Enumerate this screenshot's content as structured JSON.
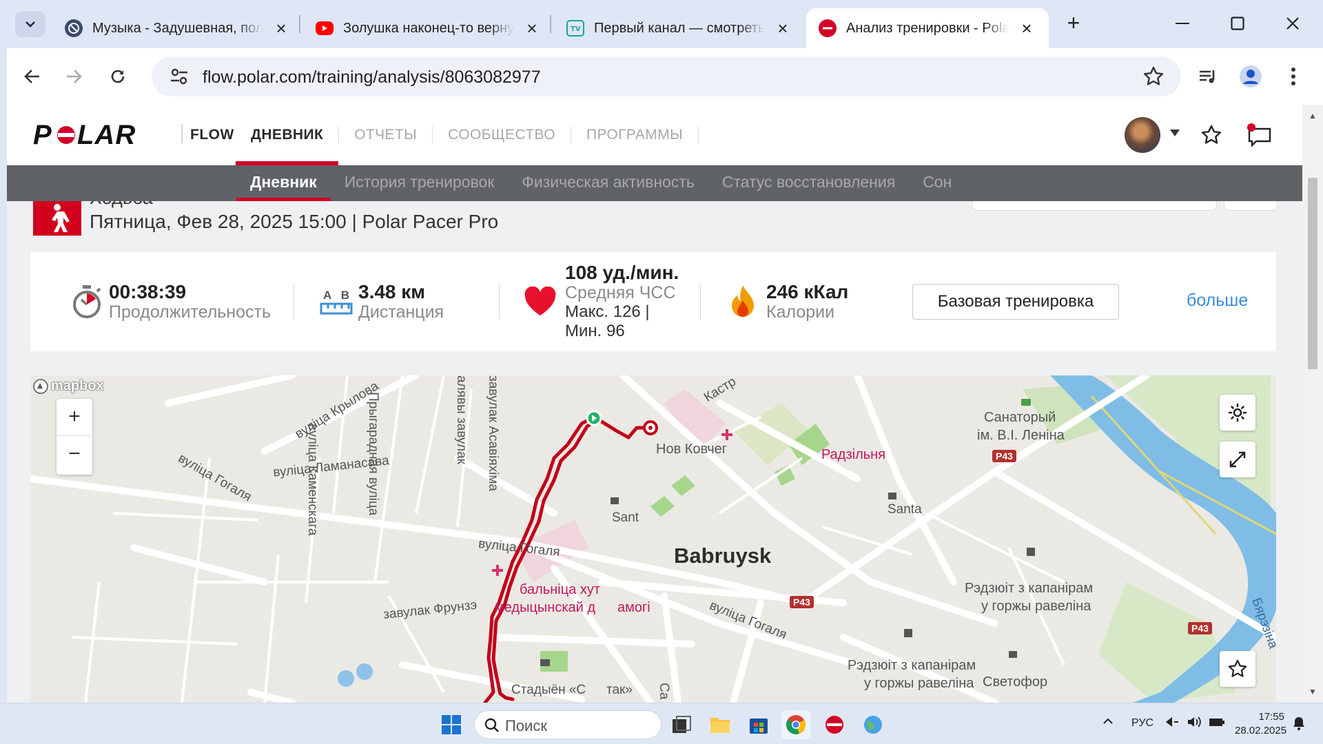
{
  "browser": {
    "tabs": [
      {
        "title": "Музыка - Задушевная, полу",
        "icon": "music-tab-icon",
        "active": false
      },
      {
        "title": "Золушка наконец-то верну",
        "icon": "youtube-icon",
        "active": false
      },
      {
        "title": "Первый канал — смотреть",
        "icon": "tv-icon",
        "active": false
      },
      {
        "title": "Анализ тренировки - Polar",
        "icon": "polar-icon",
        "active": true
      }
    ],
    "url": "flow.polar.com/training/analysis/8063082977"
  },
  "polar": {
    "flow_label": "FLOW",
    "nav": [
      {
        "label": "ДНЕВНИК",
        "active": true
      },
      {
        "label": "ОТЧЕТЫ",
        "active": false
      },
      {
        "label": "СООБЩЕСТВО",
        "active": false
      },
      {
        "label": "ПРОГРАММЫ",
        "active": false
      }
    ],
    "subnav": [
      {
        "label": "Дневник",
        "active": true
      },
      {
        "label": "История тренировок",
        "active": false
      },
      {
        "label": "Физическая активность",
        "active": false
      },
      {
        "label": "Статус восстановления",
        "active": false
      },
      {
        "label": "Сон",
        "active": false
      }
    ]
  },
  "session": {
    "sport": "Ходьба",
    "line": "Пятница, Фев 28, 2025 15:00 | Polar Pacer Pro"
  },
  "summary": {
    "duration_value": "00:38:39",
    "duration_label": "Продолжительность",
    "distance_ab": "A   B",
    "distance_value": "3.48 км",
    "distance_label": "Дистанция",
    "hr_value": "108 уд./мин.",
    "hr_label": "Средняя ЧСС",
    "hr_max": "Макс. 126  |",
    "hr_min": "Мин. 96",
    "cal_value": "246 кКал",
    "cal_label": "Калории",
    "basic_button": "Базовая тренировка",
    "more_link": "больше"
  },
  "map": {
    "brand": "mapbox",
    "zoom_in": "+",
    "zoom_out": "−",
    "labels": {
      "street_krylova": "вуліца Крылова",
      "street_kamenskaga": "вуліца Каменскага",
      "street_prygaradnaya": "Прыгарадная вуліца",
      "lane_asaviyakhima": "завулак Асавіяхіма",
      "lane_alyavy": "алявы завулак",
      "street_lamanasava": "вуліца Ламанасава",
      "street_gogalya_1": "вуліца Гогаля",
      "street_gogalya_2": "вуліца Гогаля",
      "street_gogalya_3": "вуліца Гогаля",
      "lane_frunze": "завулак Фрунзэ",
      "kastr": "Кастр",
      "novy_kovcheg": "Нов Ковчег",
      "santa_1": "Sant",
      "santa_2": "Santa",
      "city": "Babruysk",
      "hospital": "бальніца хут",
      "hospital2": "медыцынскай д",
      "hospital_tail": "амогі",
      "radzilnya": "Радзільня",
      "sanatorium": "Санаторый",
      "sanatorium2": "ім. В.І. Леніна",
      "redut1": "Рэдзюіт з капанірам",
      "redut1b": "у горжы равеліна",
      "redut2": "Рэдзюіт з капанірам",
      "redut2b": "у горжы равеліна",
      "svetofor": "Светофор",
      "stadium": "Стадыён «С",
      "stadium_tail": "так»",
      "sa": "Са",
      "bereznya": "Бярэзіна",
      "p43": "P43"
    }
  },
  "taskbar": {
    "search_placeholder": "Поиск",
    "lang": "РУС",
    "time": "17:55",
    "date": "28.02.2025"
  },
  "colors": {
    "polar_red": "#d10027",
    "route": "#c2001a",
    "link_blue": "#3a8edb",
    "subnav_bg": "#5f6267"
  }
}
